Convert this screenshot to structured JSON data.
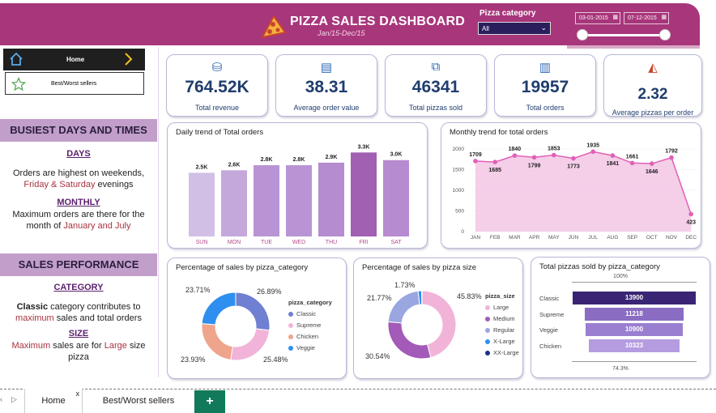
{
  "header": {
    "title": "PIZZA SALES DASHBOARD",
    "subtitle": "Jan/15-Dec/15",
    "category_label": "Pizza category",
    "category_value": "All",
    "date_start": "03-01-2015",
    "date_end": "07-12-2015",
    "accent_color": "#a8367b"
  },
  "nav": {
    "home_label": "Home",
    "best_worst_label": "Best/Worst sellers"
  },
  "left": {
    "section1_title": "BUSIEST DAYS AND TIMES",
    "days_heading": "DAYS",
    "days_text_1": "Orders are highest on weekends,",
    "days_hl": "Friday & Saturday",
    "days_text_2": " evenings",
    "monthly_heading": "MONTHLY",
    "monthly_text_1": "Maximum orders are there for the",
    "monthly_text_2": "month of ",
    "monthly_hl": "January and July",
    "section2_title": "SALES PERFORMANCE",
    "category_heading": "CATEGORY",
    "cat_b": "Classic",
    "cat_text_1": " category contributes to",
    "cat_hl": "maximum",
    "cat_text_2": " sales and total orders",
    "size_heading": "SIZE",
    "size_hl1": "Maximum",
    "size_text_1": " sales are for ",
    "size_hl2": "Large",
    "size_text_2": " size",
    "size_text_3": "pizza"
  },
  "kpis": [
    {
      "value": "764.52K",
      "label": "Total revenue",
      "icon": "revenue-icon"
    },
    {
      "value": "38.31",
      "label": "Average order value",
      "icon": "clipboard-icon"
    },
    {
      "value": "46341",
      "label": "Total pizzas sold",
      "icon": "pizza-box-icon"
    },
    {
      "value": "19957",
      "label": "Total orders",
      "icon": "orders-icon"
    },
    {
      "value": "2.32",
      "label": "Average pizzas per order",
      "icon": "pizza-slice-icon"
    }
  ],
  "chart_data": [
    {
      "type": "bar",
      "title": "Daily trend of Total orders",
      "categories": [
        "SUN",
        "MON",
        "TUE",
        "WED",
        "THU",
        "FRI",
        "SAT"
      ],
      "values": [
        2.5,
        2.6,
        2.8,
        2.8,
        2.9,
        3.3,
        3.0
      ],
      "data_labels": [
        "2.5K",
        "2.6K",
        "2.8K",
        "2.8K",
        "2.9K",
        "3.3K",
        "3.0K"
      ]
    },
    {
      "type": "area",
      "title": "Monthly trend for total orders",
      "categories": [
        "JAN",
        "FEB",
        "MAR",
        "APR",
        "MAY",
        "JUN",
        "JUL",
        "AUG",
        "SEP",
        "OCT",
        "NOV",
        "DEC"
      ],
      "values": [
        1709,
        1685,
        1840,
        1799,
        1853,
        1773,
        1935,
        1841,
        1661,
        1646,
        1792,
        423
      ],
      "y_ticks": [
        "0",
        "500",
        "1000",
        "1500",
        "2000"
      ],
      "ylim": [
        0,
        2000
      ]
    },
    {
      "type": "pie",
      "title": "Percentage of sales by pizza_category",
      "legend_title": "pizza_category",
      "labels": [
        "Classic",
        "Supreme",
        "Chicken",
        "Veggie"
      ],
      "values": [
        26.89,
        25.48,
        23.93,
        23.71
      ],
      "value_labels": [
        "26.89%",
        "25.48%",
        "23.93%",
        "23.71%"
      ],
      "colors": [
        "#6f7fd1",
        "#f1b4d8",
        "#efa48c",
        "#2f8ff0"
      ]
    },
    {
      "type": "pie",
      "title": "Percentage of sales by pizza size",
      "legend_title": "pizza_size",
      "labels": [
        "Large",
        "Medium",
        "Regular",
        "X-Large",
        "XX-Large"
      ],
      "values": [
        45.83,
        30.54,
        21.77,
        1.73,
        0.12
      ],
      "value_labels": [
        "45.83%",
        "30.54%",
        "21.77%",
        "1.73%"
      ],
      "colors": [
        "#f1b4d8",
        "#a35ab8",
        "#9aa6e0",
        "#2f8ff0",
        "#1d2f8a"
      ]
    },
    {
      "type": "bar",
      "title": "Total pizzas sold by pizza_category",
      "categories": [
        "Classic",
        "Supreme",
        "Veggie",
        "Chicken"
      ],
      "values": [
        13900,
        11218,
        10900,
        10323
      ],
      "top_pct": "100%",
      "bottom_pct": "74.3%",
      "colors": [
        "#3a2575",
        "#8a6cc2",
        "#9a7fd0",
        "#b59ce0"
      ]
    }
  ],
  "tabs": {
    "home": "Home",
    "best": "Best/Worst sellers",
    "close": "x",
    "add": "+"
  }
}
